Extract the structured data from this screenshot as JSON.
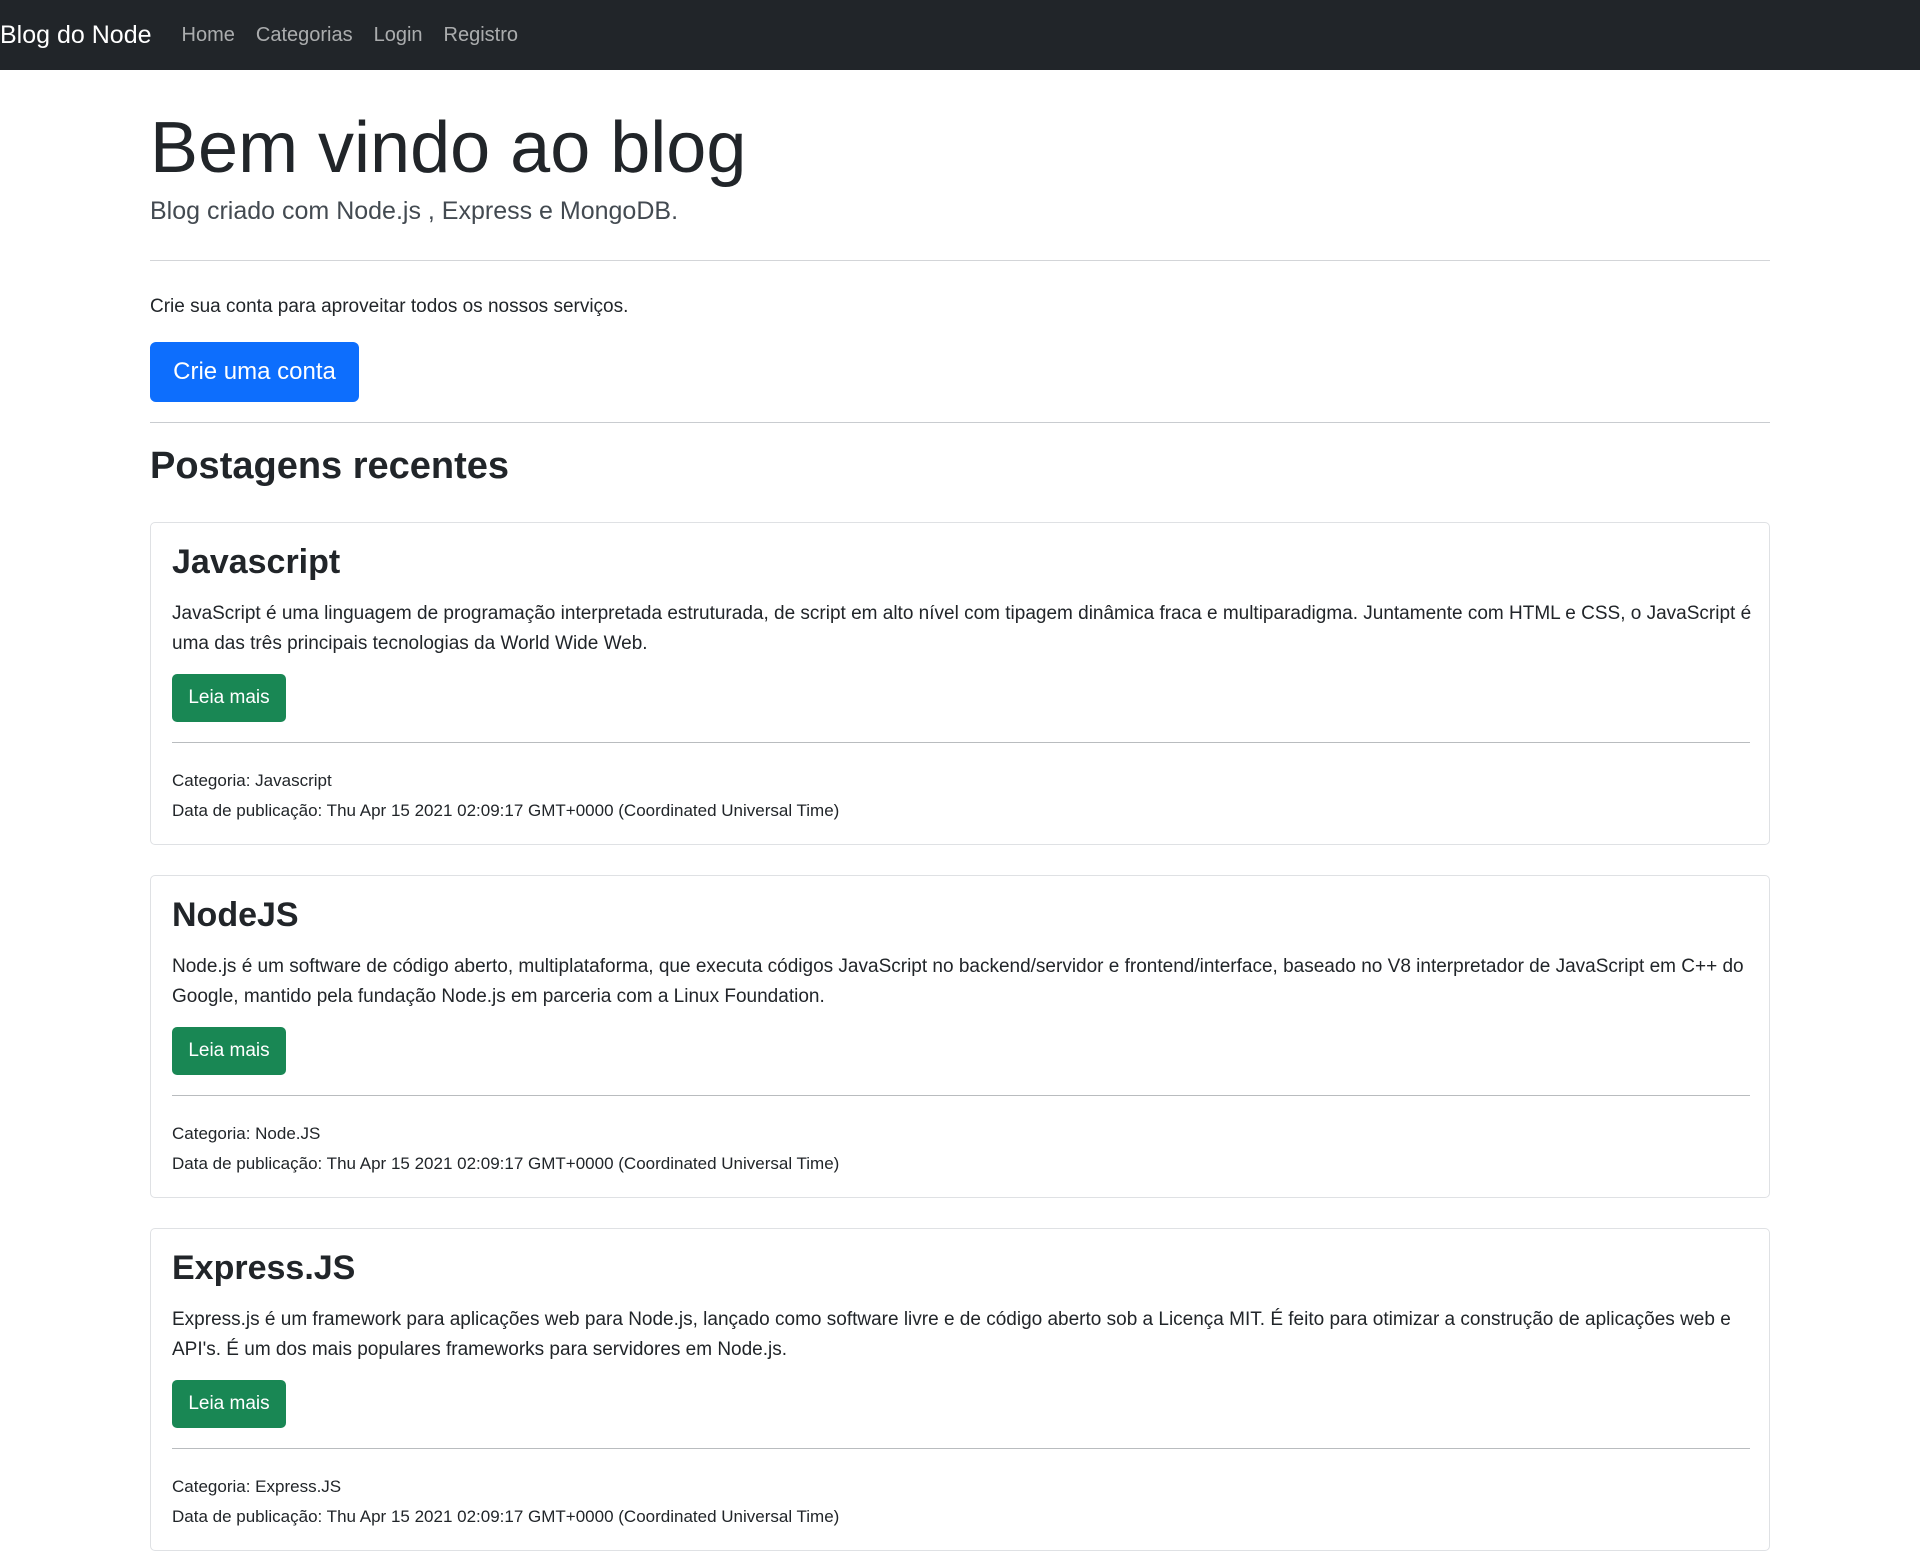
{
  "navbar": {
    "brand": "Blog do Node",
    "links": [
      "Home",
      "Categorias",
      "Login",
      "Registro"
    ]
  },
  "jumbotron": {
    "title": "Bem vindo ao blog",
    "subtitle": "Blog criado com Node.js , Express e MongoDB.",
    "intro": "Crie sua conta para aproveitar todos os nossos serviços.",
    "cta_label": "Crie uma conta"
  },
  "section_title": "Postagens recentes",
  "posts": [
    {
      "title": "Javascript",
      "description": "JavaScript é uma linguagem de programação interpretada estruturada, de script em alto nível com tipagem dinâmica fraca e multiparadigma. Juntamente com HTML e CSS, o JavaScript é uma das três principais tecnologias da World Wide Web.",
      "button": "Leia mais",
      "category": "Categoria: Javascript",
      "date": "Data de publicação: Thu Apr 15 2021 02:09:17 GMT+0000 (Coordinated Universal Time)"
    },
    {
      "title": "NodeJS",
      "description": "Node.js é um software de código aberto, multiplataforma, que executa códigos JavaScript no backend/servidor e frontend/interface, baseado no V8 interpretador de JavaScript em C++ do Google, mantido pela fundação Node.js em parceria com a Linux Foundation.",
      "button": "Leia mais",
      "category": "Categoria: Node.JS",
      "date": "Data de publicação: Thu Apr 15 2021 02:09:17 GMT+0000 (Coordinated Universal Time)"
    },
    {
      "title": "Express.JS",
      "description": "Express.js é um framework para aplicações web para Node.js, lançado como software livre e de código aberto sob a Licença MIT. É feito para otimizar a construção de aplicações web e API's. É um dos mais populares frameworks para servidores em Node.js.",
      "button": "Leia mais",
      "category": "Categoria: Express.JS",
      "date": "Data de publicação: Thu Apr 15 2021 02:09:17 GMT+0000 (Coordinated Universal Time)"
    }
  ],
  "colors": {
    "navbar_bg": "#212529",
    "primary": "#0d6efd",
    "success": "#198754"
  }
}
